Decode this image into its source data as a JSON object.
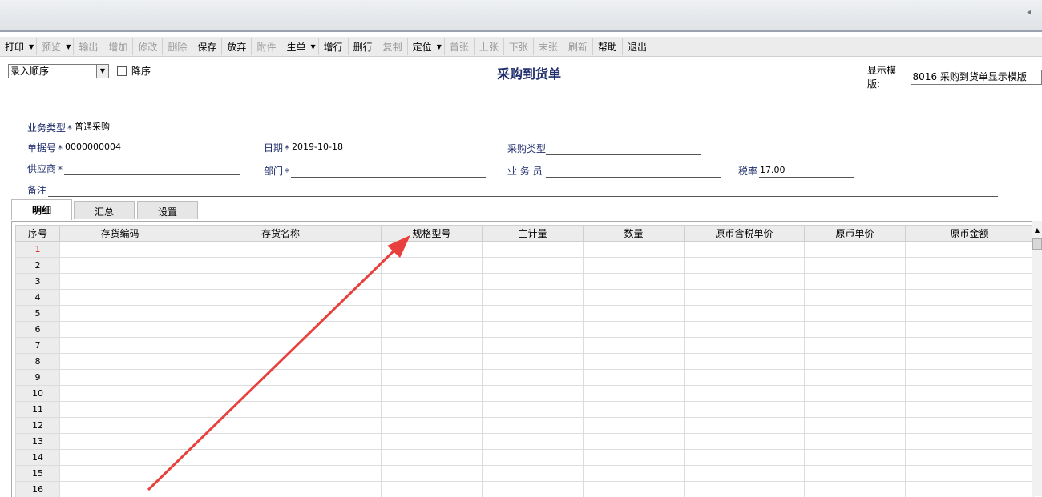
{
  "toolbar": {
    "items": [
      {
        "label": "打印",
        "dropdown": true,
        "disabled": false
      },
      {
        "label": "预览",
        "dropdown": true,
        "disabled": true
      },
      {
        "label": "输出",
        "dropdown": false,
        "disabled": true
      },
      {
        "label": "增加",
        "dropdown": false,
        "disabled": true
      },
      {
        "label": "修改",
        "dropdown": false,
        "disabled": true
      },
      {
        "label": "删除",
        "dropdown": false,
        "disabled": true
      },
      {
        "label": "保存",
        "dropdown": false,
        "disabled": false
      },
      {
        "label": "放弃",
        "dropdown": false,
        "disabled": false
      },
      {
        "label": "附件",
        "dropdown": false,
        "disabled": true
      },
      {
        "label": "生单",
        "dropdown": true,
        "disabled": false
      },
      {
        "label": "增行",
        "dropdown": false,
        "disabled": false
      },
      {
        "label": "删行",
        "dropdown": false,
        "disabled": false
      },
      {
        "label": "复制",
        "dropdown": false,
        "disabled": true
      },
      {
        "label": "定位",
        "dropdown": true,
        "disabled": false
      },
      {
        "label": "首张",
        "dropdown": false,
        "disabled": true
      },
      {
        "label": "上张",
        "dropdown": false,
        "disabled": true
      },
      {
        "label": "下张",
        "dropdown": false,
        "disabled": true
      },
      {
        "label": "末张",
        "dropdown": false,
        "disabled": true
      },
      {
        "label": "刷新",
        "dropdown": false,
        "disabled": true
      },
      {
        "label": "帮助",
        "dropdown": false,
        "disabled": false
      },
      {
        "label": "退出",
        "dropdown": false,
        "disabled": false
      }
    ]
  },
  "order_select": {
    "value": "录入顺序"
  },
  "descending": {
    "label": "降序",
    "checked": false
  },
  "form_title": "采购到货单",
  "template": {
    "label": "显示模版:",
    "value": "8016 采购到货单显示模版"
  },
  "fields": {
    "biz_type": {
      "label": "业务类型",
      "value": "普通采购"
    },
    "doc_no": {
      "label": "单据号",
      "value": "0000000004"
    },
    "date": {
      "label": "日期",
      "value": "2019-10-18"
    },
    "purchase_type": {
      "label": "采购类型",
      "value": ""
    },
    "supplier": {
      "label": "供应商",
      "value": ""
    },
    "department": {
      "label": "部门",
      "value": ""
    },
    "salesperson": {
      "label": "业 务 员",
      "value": ""
    },
    "tax_rate": {
      "label": "税率",
      "value": "17.00"
    },
    "remark": {
      "label": "备注",
      "value": ""
    }
  },
  "required_mark": "*",
  "tabs": [
    "明细",
    "汇总",
    "设置"
  ],
  "grid": {
    "columns": [
      "序号",
      "存货编码",
      "存货名称",
      "规格型号",
      "主计量",
      "数量",
      "原币含税单价",
      "原币单价",
      "原币金额"
    ],
    "rows": [
      "1",
      "2",
      "3",
      "4",
      "5",
      "6",
      "7",
      "8",
      "9",
      "10",
      "11",
      "12",
      "13",
      "14",
      "15",
      "16"
    ]
  },
  "colors": {
    "title": "#1f2d6b",
    "annotation_arrow": "#e8403c",
    "current_row": "#d02020"
  }
}
